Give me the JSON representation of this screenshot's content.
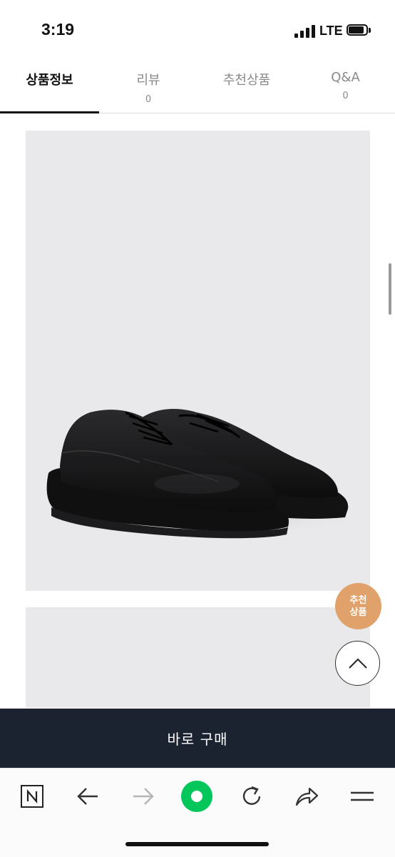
{
  "status_bar": {
    "time": "3:19",
    "network": "LTE"
  },
  "tabs": [
    {
      "label": "상품정보",
      "count": "",
      "active": true
    },
    {
      "label": "리뷰",
      "count": "0",
      "active": false
    },
    {
      "label": "추천상품",
      "count": "",
      "active": false
    },
    {
      "label": "Q&A",
      "count": "0",
      "active": false
    }
  ],
  "floating": {
    "recommend_line1": "추천",
    "recommend_line2": "상품"
  },
  "buy_bar": {
    "label": "바로 구매"
  },
  "toolbar": {
    "icons": [
      "naver-icon",
      "back-arrow-icon",
      "forward-arrow-icon",
      "green-dot-icon",
      "refresh-icon",
      "share-icon",
      "menu-icon"
    ]
  },
  "colors": {
    "buy_bar": "#1b2230",
    "recommend_badge": "#e0a26a",
    "green_button": "#03c75a",
    "image_background": "#e9e9eb"
  }
}
